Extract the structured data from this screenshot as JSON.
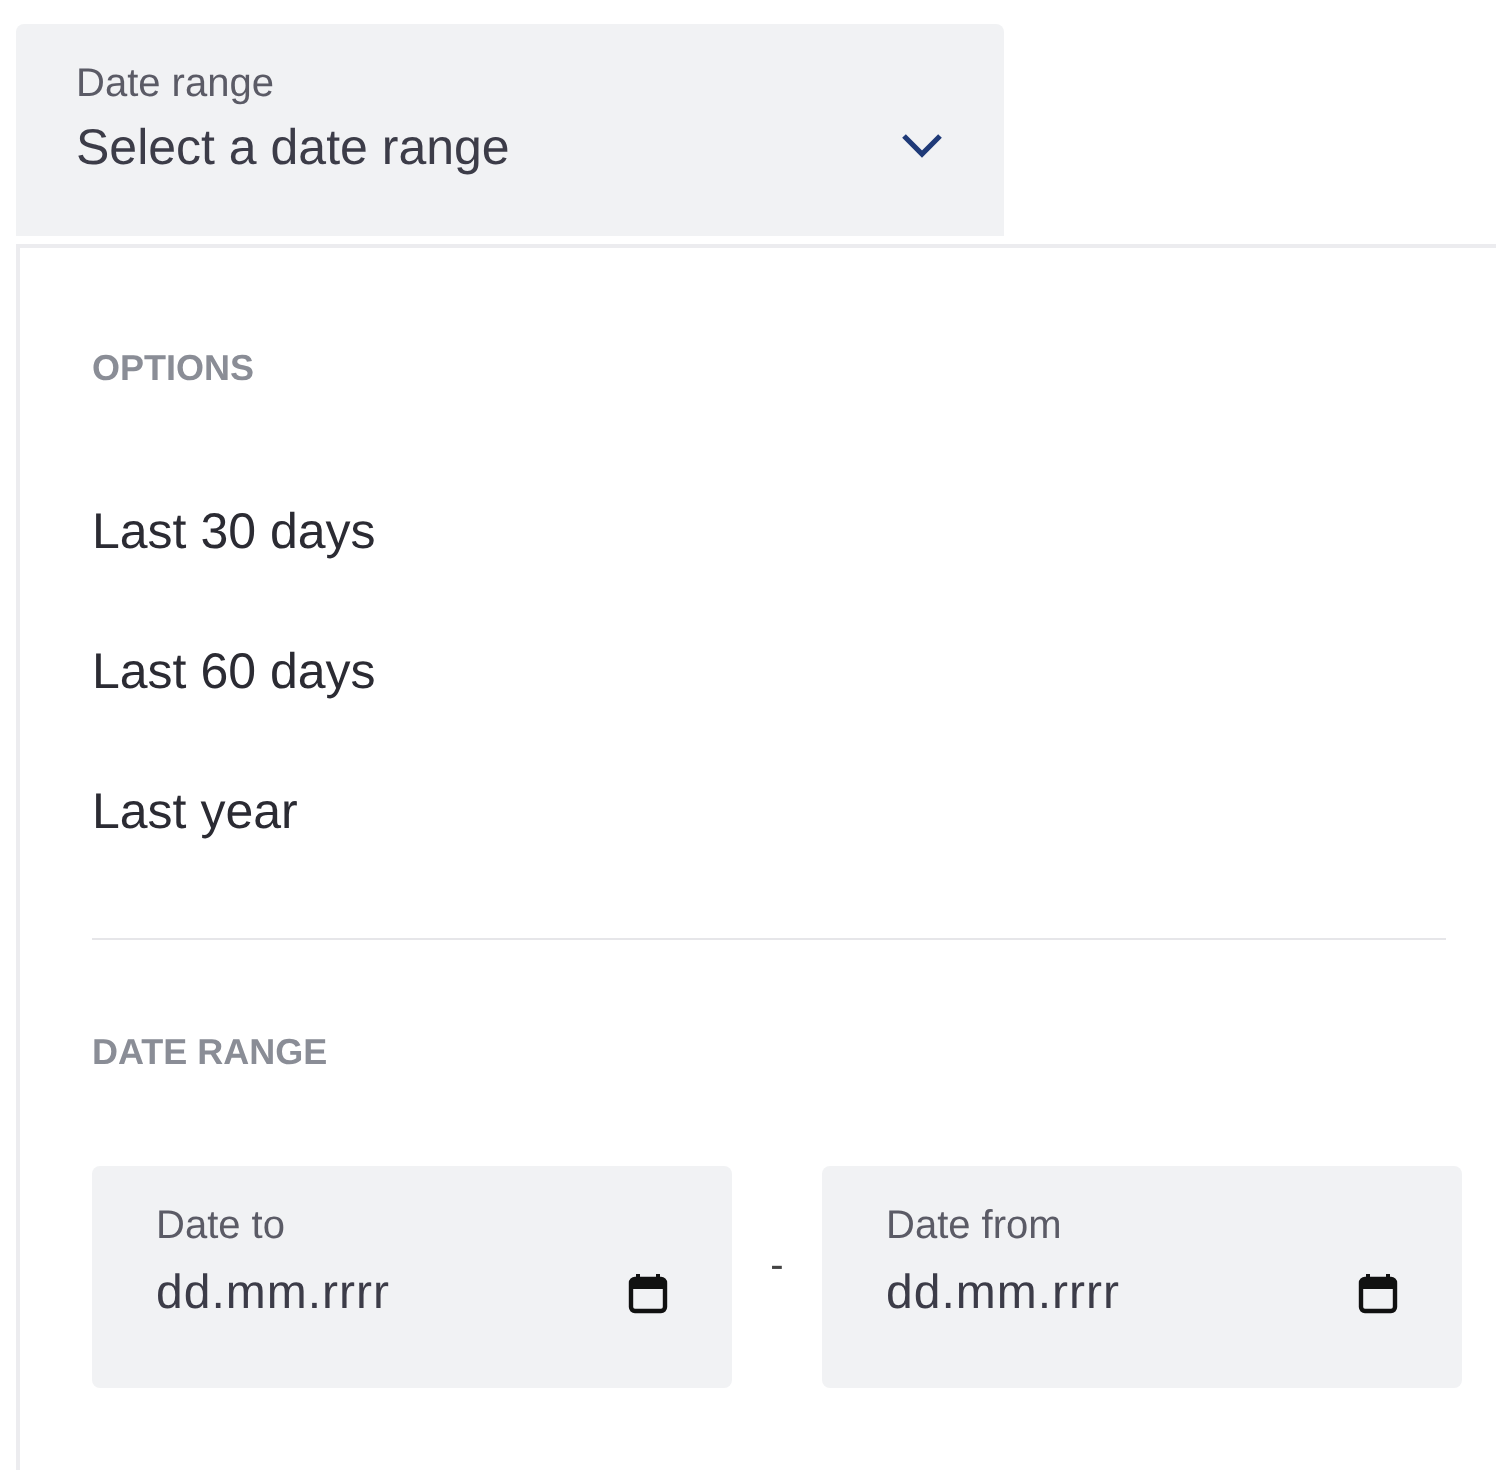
{
  "select": {
    "label": "Date range",
    "placeholder": "Select a date range",
    "expanded": true
  },
  "options_heading": "OPTIONS",
  "options": [
    {
      "label": "Last 30 days"
    },
    {
      "label": "Last 60 days"
    },
    {
      "label": "Last year"
    }
  ],
  "range_heading": "DATE RANGE",
  "date_fields": [
    {
      "label": "Date to",
      "placeholder": "dd.mm.rrrr"
    },
    {
      "label": "Date from",
      "placeholder": "dd.mm.rrrr"
    }
  ],
  "separator": "-"
}
